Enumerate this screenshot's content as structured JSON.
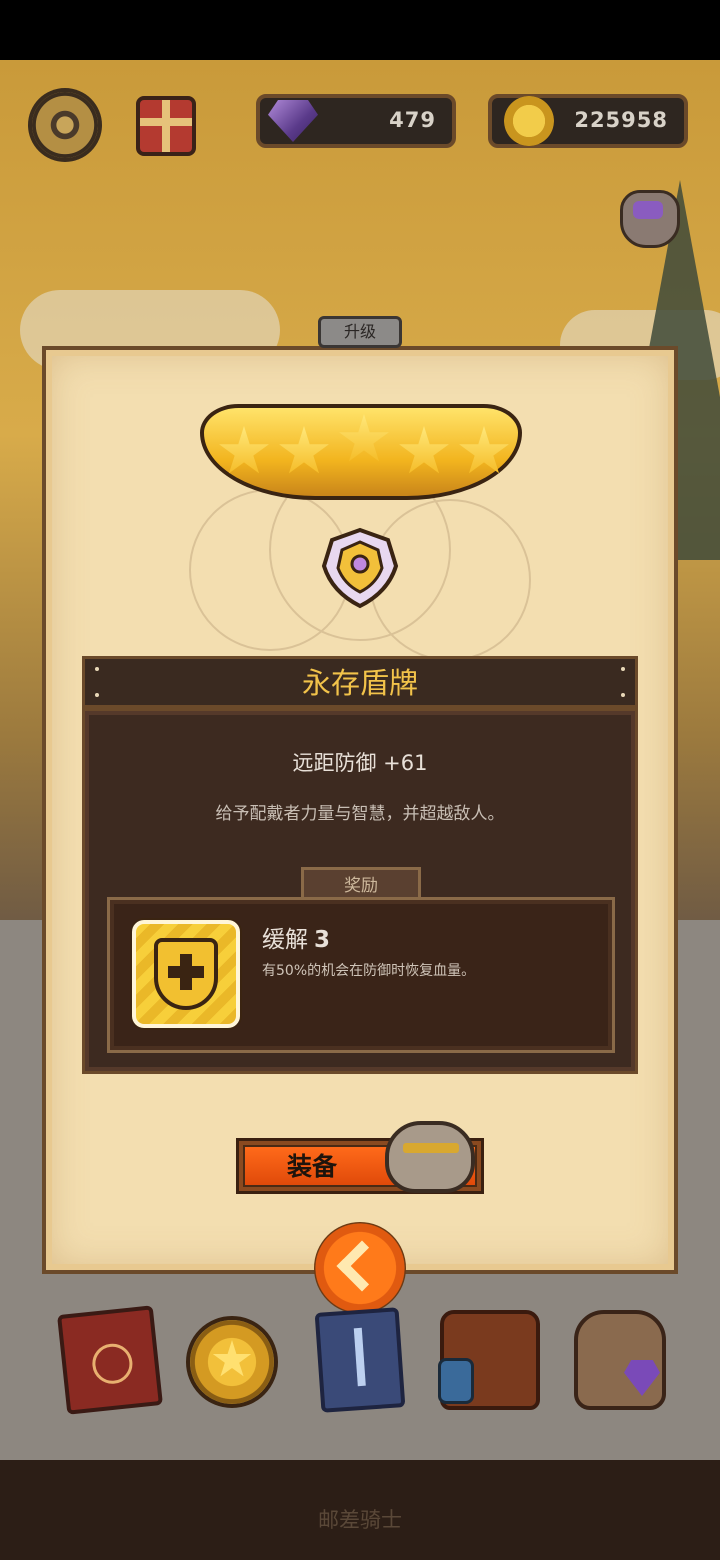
{
  "hud": {
    "gems": "479",
    "coins": "225958"
  },
  "panel": {
    "tab_label": "升级",
    "stars": 5,
    "item_name": "永存盾牌",
    "stat": "远距防御 +61",
    "description": "给予配戴者力量与智慧，并超越敌人。",
    "reward_tab": "奖励",
    "perk": {
      "name": "缓解",
      "level": "3",
      "description": "有50%的机会在防御时恢复血量。"
    },
    "equip_label": "装备"
  },
  "footer": {
    "text": "邮差骑士"
  },
  "icons": {
    "settings": "gear-icon",
    "gift": "gift-icon",
    "gem": "gem-icon",
    "coin": "coin-icon",
    "back": "chevron-left-icon"
  }
}
